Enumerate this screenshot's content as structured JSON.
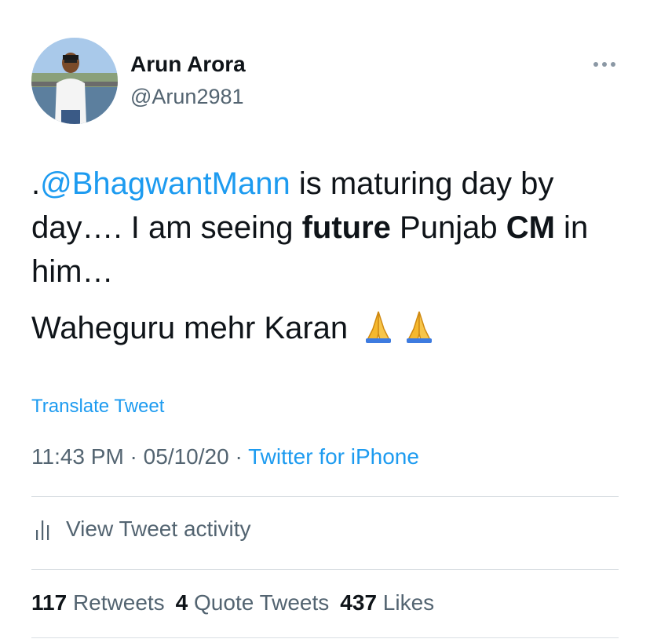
{
  "author": {
    "name": "Arun Arora",
    "handle": "@Arun2981"
  },
  "tweet": {
    "line1_prefix": ".",
    "mention": "@BhagwantMann",
    "text_a": " is maturing day by day…. I am seeing ",
    "bold_a": "future",
    "text_b": " Punjab ",
    "bold_b": "CM",
    "text_c": " in him…",
    "second_paragraph": "Waheguru mehr Karan",
    "emoji_icon": "folded-hands-icon"
  },
  "translate_label": "Translate Tweet",
  "meta": {
    "time": "11:43 PM",
    "sep1": " · ",
    "date": "05/10/20",
    "sep2": " · ",
    "source": "Twitter for iPhone"
  },
  "activity_label": "View Tweet activity",
  "stats": {
    "retweets_count": "117",
    "retweets_label": "Retweets",
    "quotes_count": "4",
    "quotes_label": "Quote Tweets",
    "likes_count": "437",
    "likes_label": "Likes"
  },
  "colors": {
    "accent": "#1d9bf0",
    "text": "#0f1419",
    "secondary": "#536471",
    "divider": "#dadfe3"
  }
}
